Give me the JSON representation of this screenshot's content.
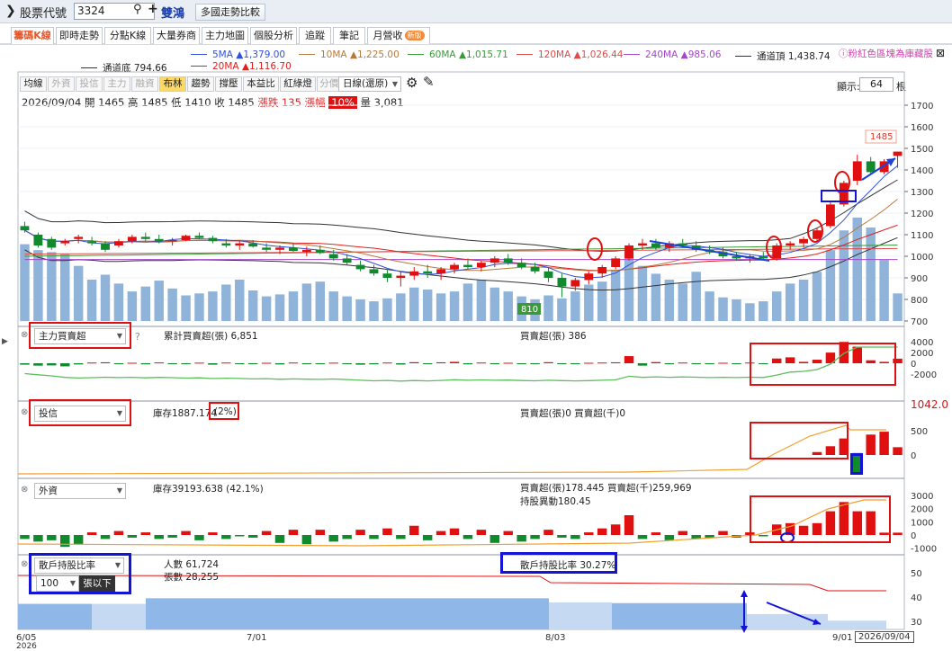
{
  "header": {
    "title": "股票代號",
    "stock_code": "3324",
    "stock_name": "雙鴻",
    "compare_button": "多國走勢比較"
  },
  "tabs": [
    {
      "label": "籌碼K線",
      "active": true
    },
    {
      "label": "即時走勢"
    },
    {
      "label": "分點K線"
    },
    {
      "label": "大量券商"
    },
    {
      "label": "主力地圖"
    },
    {
      "label": "個股分析"
    },
    {
      "label": "追蹤"
    },
    {
      "label": "筆記"
    },
    {
      "label": "月營收",
      "badge": "新版"
    }
  ],
  "ma_legend": {
    "ma5": "5MA ▲1,379.00",
    "ma10": "10MA ▲1,225.00",
    "ma60": "60MA ▲1,015.71",
    "ma120": "120MA ▲1,026.44",
    "ma240": "240MA ▲985.06",
    "channel_top": "通道頂 1,438.74",
    "channel_bottom": "通道底 794.66",
    "ma20": "20MA ▲1,116.70",
    "note": "粉紅色區塊為庫藏股",
    "colors": {
      "ma5": "#3050d8",
      "ma10": "#b9793a",
      "ma60": "#3a9a3a",
      "ma120": "#e04a4a",
      "ma240": "#a447c8",
      "channel": "#333333",
      "ma20": "#e02020"
    }
  },
  "toolbar": {
    "buttons": [
      "均線",
      "外資",
      "投信",
      "主力",
      "融資",
      "布林",
      "趨勢",
      "撐壓",
      "本益比",
      "紅綠燈",
      "分價量"
    ],
    "active": "布林",
    "dim": [
      "外資",
      "投信",
      "主力",
      "融資",
      "分價量"
    ],
    "period_select": "日線(還原)",
    "display_label": "顯示:",
    "display_count": "64",
    "display_unit": "根"
  },
  "ohlc": {
    "date": "2026/09/04",
    "open_label": "開",
    "open": "1465",
    "high_label": "高",
    "high": "1485",
    "low_label": "低",
    "low": "1410",
    "close_label": "收",
    "close": "1485",
    "change_label": "漲跌",
    "change": "135",
    "pct_label": "漲幅",
    "pct": "10%",
    "vol_label": "量",
    "vol": "3,081"
  },
  "price_axis": [
    "1700",
    "1600",
    "1500",
    "1400",
    "1300",
    "1200",
    "1100",
    "1000",
    "900",
    "800",
    "700"
  ],
  "price_tags": {
    "last": "1485",
    "low_mark": "810"
  },
  "panels": {
    "main_force": {
      "select": "主力買賣超",
      "help": "?",
      "line_label": "累計買賣超(張) 6,851",
      "bar_label": "買賣超(張) 386",
      "axis": [
        "4000",
        "2000",
        "0",
        "-2000"
      ]
    },
    "trust": {
      "select": "投信",
      "line_label": "庫存1887.174",
      "pct": "(2%)",
      "bar_label": "買賣超(張)0 買賣超(千)0",
      "axis": [
        "500",
        "0"
      ],
      "side_value": "1042.0"
    },
    "foreign": {
      "select": "外資",
      "line_label": "庫存39193.638 (42.1%)",
      "bar_label": "買賣超(張)178.445 買賣超(千)259,969",
      "hold_label": "持股異動180.45",
      "axis": [
        "3000",
        "2000",
        "1000",
        "0",
        "-1000"
      ]
    },
    "holders": {
      "select": "散戶持股比率",
      "threshold": "100",
      "threshold_unit": "張以下",
      "people_label": "人數 61,724",
      "shares_label": "張數 28,255",
      "ratio_label": "散戶持股比率 30.27%",
      "axis": [
        "50",
        "40",
        "30"
      ]
    }
  },
  "x_axis": {
    "labels": [
      "6/05",
      "7/01",
      "8/03",
      "9/01"
    ],
    "year": "2026",
    "current": "2026/09/04"
  },
  "chart_data": {
    "type": "candlestick",
    "ylim": [
      700,
      1700
    ],
    "candles": [
      [
        1140,
        1160,
        1110,
        1120
      ],
      [
        1100,
        1110,
        1040,
        1050
      ],
      [
        1080,
        1090,
        1030,
        1040
      ],
      [
        1060,
        1080,
        1050,
        1070
      ],
      [
        1080,
        1100,
        1060,
        1090
      ],
      [
        1070,
        1090,
        1050,
        1060
      ],
      [
        1060,
        1070,
        1020,
        1030
      ],
      [
        1050,
        1080,
        1040,
        1070
      ],
      [
        1070,
        1100,
        1060,
        1090
      ],
      [
        1090,
        1110,
        1070,
        1080
      ],
      [
        1080,
        1100,
        1060,
        1070
      ],
      [
        1070,
        1085,
        1050,
        1075
      ],
      [
        1075,
        1100,
        1070,
        1095
      ],
      [
        1095,
        1110,
        1080,
        1085
      ],
      [
        1085,
        1095,
        1060,
        1070
      ],
      [
        1060,
        1080,
        1040,
        1050
      ],
      [
        1050,
        1070,
        1030,
        1060
      ],
      [
        1060,
        1075,
        1040,
        1045
      ],
      [
        1040,
        1060,
        1020,
        1030
      ],
      [
        1030,
        1050,
        1010,
        1040
      ],
      [
        1040,
        1060,
        1020,
        1025
      ],
      [
        1020,
        1045,
        1000,
        1030
      ],
      [
        1030,
        1050,
        1010,
        1015
      ],
      [
        1010,
        1030,
        980,
        990
      ],
      [
        990,
        1010,
        960,
        970
      ],
      [
        960,
        980,
        930,
        940
      ],
      [
        940,
        960,
        910,
        920
      ],
      [
        920,
        940,
        880,
        900
      ],
      [
        900,
        930,
        860,
        910
      ],
      [
        910,
        950,
        890,
        930
      ],
      [
        930,
        960,
        900,
        920
      ],
      [
        920,
        950,
        890,
        940
      ],
      [
        940,
        970,
        920,
        960
      ],
      [
        960,
        990,
        940,
        950
      ],
      [
        950,
        980,
        930,
        970
      ],
      [
        970,
        1000,
        950,
        990
      ],
      [
        990,
        1010,
        960,
        970
      ],
      [
        970,
        990,
        940,
        950
      ],
      [
        950,
        970,
        920,
        930
      ],
      [
        930,
        950,
        880,
        900
      ],
      [
        900,
        920,
        810,
        860
      ],
      [
        860,
        900,
        840,
        890
      ],
      [
        890,
        930,
        870,
        920
      ],
      [
        920,
        960,
        900,
        950
      ],
      [
        950,
        1000,
        940,
        990
      ],
      [
        990,
        1060,
        980,
        1050
      ],
      [
        1050,
        1080,
        1030,
        1060
      ],
      [
        1060,
        1080,
        1030,
        1040
      ],
      [
        1040,
        1070,
        1020,
        1060
      ],
      [
        1060,
        1080,
        1040,
        1050
      ],
      [
        1050,
        1070,
        1020,
        1030
      ],
      [
        1030,
        1050,
        1010,
        1020
      ],
      [
        1020,
        1040,
        990,
        1000
      ],
      [
        1000,
        1020,
        980,
        990
      ],
      [
        990,
        1010,
        970,
        1000
      ],
      [
        1000,
        1020,
        980,
        990
      ],
      [
        990,
        1060,
        980,
        1050
      ],
      [
        1050,
        1070,
        1030,
        1060
      ],
      [
        1060,
        1090,
        1040,
        1080
      ],
      [
        1080,
        1130,
        1070,
        1120
      ],
      [
        1140,
        1250,
        1130,
        1240
      ],
      [
        1240,
        1350,
        1230,
        1340
      ],
      [
        1350,
        1470,
        1330,
        1440
      ],
      [
        1440,
        1460,
        1380,
        1390
      ],
      [
        1390,
        1450,
        1380,
        1440
      ],
      [
        1465,
        1485,
        1410,
        1485
      ]
    ],
    "volume": [
      780,
      720,
      700,
      680,
      560,
      420,
      470,
      380,
      300,
      350,
      410,
      330,
      260,
      280,
      300,
      370,
      420,
      310,
      250,
      270,
      300,
      380,
      400,
      300,
      250,
      220,
      200,
      230,
      280,
      340,
      320,
      280,
      300,
      380,
      420,
      340,
      300,
      250,
      220,
      260,
      230,
      300,
      370,
      400,
      520,
      700,
      560,
      480,
      420,
      380,
      500,
      300,
      240,
      220,
      180,
      200,
      300,
      380,
      420,
      500,
      720,
      920,
      1050,
      950,
      620,
      280
    ]
  }
}
